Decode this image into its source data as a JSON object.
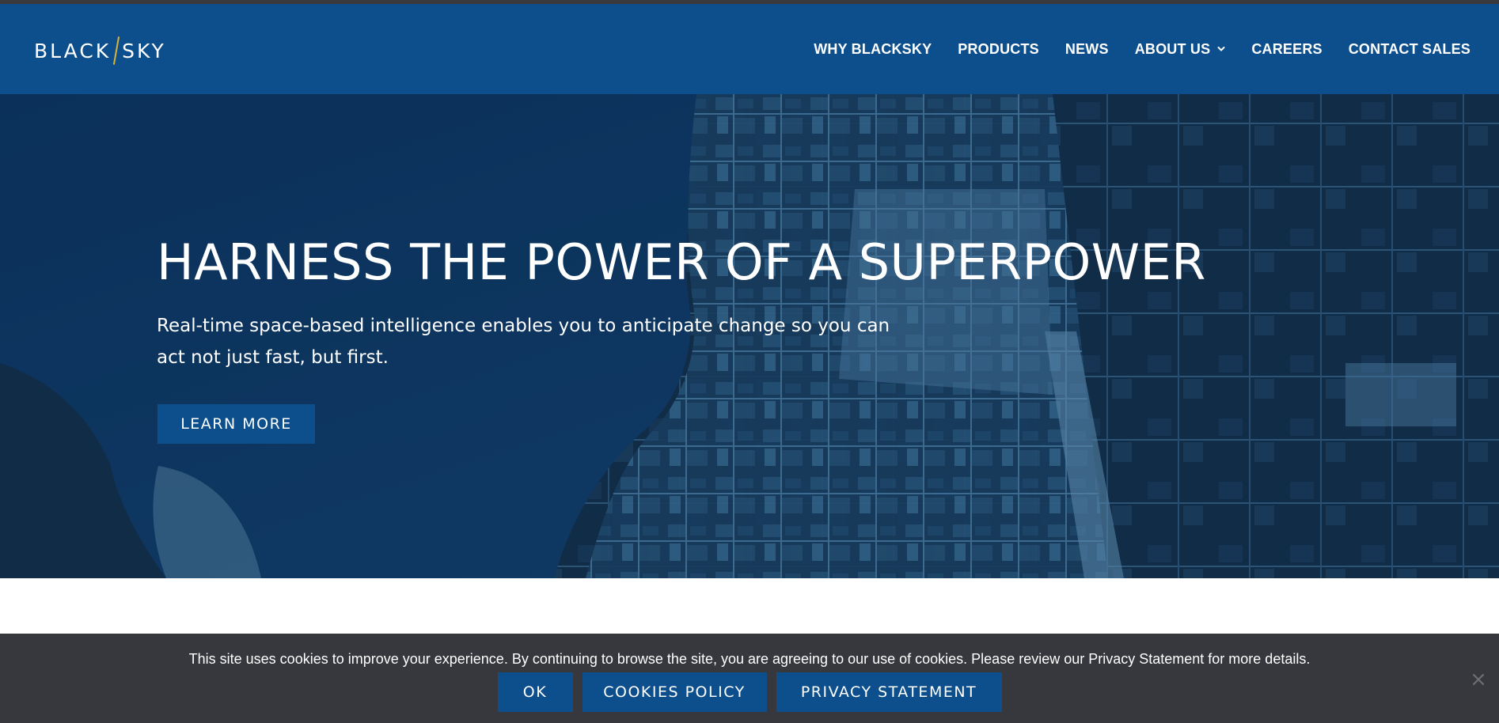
{
  "brand": {
    "logo_left": "BLACK",
    "logo_right": "SKY",
    "accent_color": "#d9b23a",
    "primary_color": "#0c4f8c"
  },
  "nav": {
    "items": [
      {
        "label": "WHY BLACKSKY"
      },
      {
        "label": "PRODUCTS"
      },
      {
        "label": "NEWS"
      },
      {
        "label": "ABOUT US",
        "has_dropdown": true,
        "icon": "chevron-down-icon"
      },
      {
        "label": "CAREERS"
      },
      {
        "label": "CONTACT SALES"
      }
    ]
  },
  "hero": {
    "title": "HARNESS THE POWER OF A SUPERPOWER",
    "subtitle": "Real-time space-based intelligence enables you to anticipate change so you can act not just fast, but first.",
    "cta_label": "LEARN MORE",
    "background": "satellite-image-of-coastal-port"
  },
  "cookie_bar": {
    "message": "This site uses cookies to improve your experience. By continuing to browse the site, you are agreeing to our use of cookies. Please review our Privacy Statement for more details.",
    "ok_label": "OK",
    "policy_label": "COOKIES POLICY",
    "privacy_label": "PRIVACY STATEMENT",
    "close_icon": "close-icon"
  }
}
